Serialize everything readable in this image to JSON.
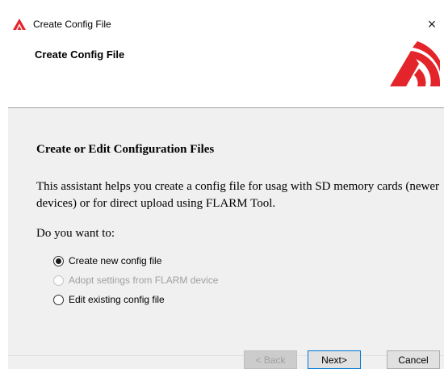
{
  "window": {
    "title": "Create Config File",
    "close_glyph": "×",
    "app_icon": "flarm-logo-icon",
    "brand_color": "#e3252b"
  },
  "header": {
    "title": "Create Config File",
    "logo": "flarm-logo-icon"
  },
  "content": {
    "section_title": "Create or Edit Configuration Files",
    "description": "This assistant helps you create a config file for usag with SD memory cards (newer devices) or for direct upload using FLARM Tool.",
    "prompt": "Do you want to:",
    "options": [
      {
        "label": "Create new config file",
        "selected": true,
        "enabled": true
      },
      {
        "label": "Adopt settings from FLARM device",
        "selected": false,
        "enabled": false
      },
      {
        "label": "Edit existing config file",
        "selected": false,
        "enabled": true
      }
    ]
  },
  "buttons": {
    "back": "< Back",
    "next": "Next>",
    "cancel": "Cancel"
  }
}
